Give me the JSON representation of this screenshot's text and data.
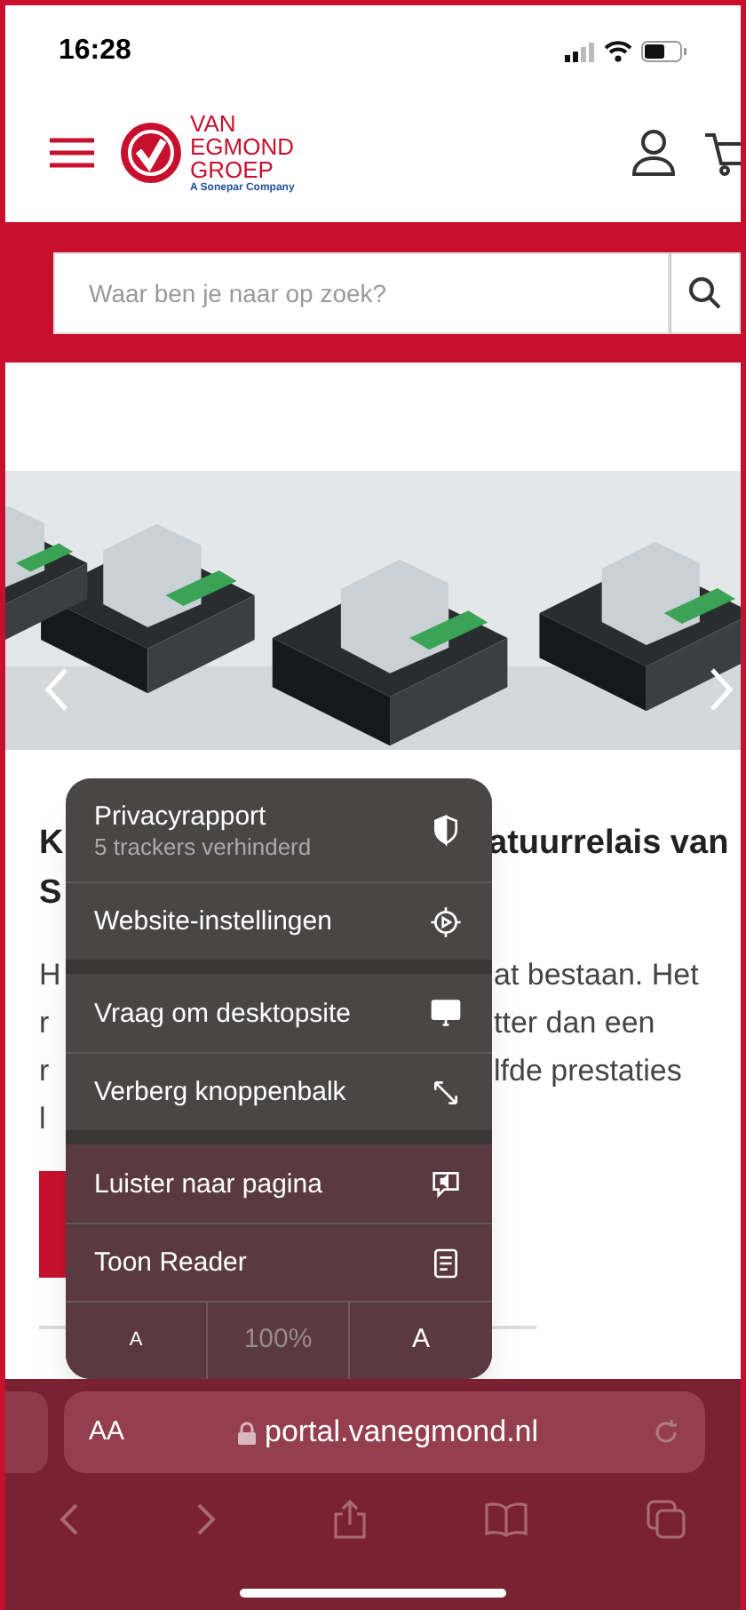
{
  "status_bar": {
    "time": "16:28"
  },
  "header": {
    "logo": {
      "lines": [
        "VAN",
        "EGMOND",
        "GROEP"
      ],
      "tagline": "A Sonepar Company"
    }
  },
  "search": {
    "placeholder": "Waar ben je naar op zoek?"
  },
  "article": {
    "heading_lines": [
      {
        "left": "K",
        "right": "atuurrelais van"
      },
      {
        "left": "S"
      }
    ],
    "body_lines": [
      {
        "left": "H",
        "right": "at bestaan. Het"
      },
      {
        "left": "r",
        "right": "tter dan een"
      },
      {
        "left": "r",
        "right": "lfde prestaties"
      },
      {
        "left": "l"
      }
    ]
  },
  "menu": {
    "groups": [
      [
        {
          "label": "Privacyrapport",
          "subtitle": "5 trackers verhinderd"
        },
        {
          "label": "Website-instellingen"
        }
      ],
      [
        {
          "label": "Vraag om desktopsite"
        },
        {
          "label": "Verberg knoppenbalk"
        }
      ],
      [
        {
          "label": "Luister naar pagina"
        },
        {
          "label": "Toon Reader"
        }
      ]
    ],
    "zoom": {
      "smaller": "A",
      "level": "100%",
      "larger": "A"
    }
  },
  "address_bar": {
    "text_size": "AA",
    "url": "portal.vanegmond.nl"
  }
}
